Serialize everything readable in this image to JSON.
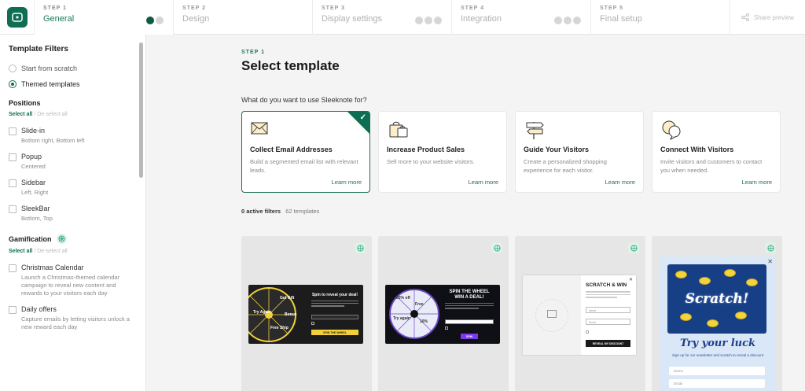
{
  "steps": [
    {
      "num": "STEP 1",
      "label": "General",
      "active": true
    },
    {
      "num": "STEP 2",
      "label": "Design"
    },
    {
      "num": "STEP 3",
      "label": "Display settings"
    },
    {
      "num": "STEP 4",
      "label": "Integration"
    },
    {
      "num": "STEP 5",
      "label": "Final setup"
    }
  ],
  "share_label": "Share preview",
  "sidebar": {
    "title": "Template Filters",
    "radio": [
      "Start from scratch",
      "Themed templates"
    ],
    "positions": {
      "title": "Positions",
      "select_all": "Select all",
      "separator": "/",
      "deselect_all": "De-select all",
      "items": [
        {
          "title": "Slide-in",
          "sub": "Bottom right, Bottom left"
        },
        {
          "title": "Popup",
          "sub": "Centered"
        },
        {
          "title": "Sidebar",
          "sub": "Left, Right"
        },
        {
          "title": "SleekBar",
          "sub": "Bottom, Top"
        }
      ]
    },
    "gamification": {
      "title": "Gamification",
      "select_all": "Select all",
      "separator": "/",
      "deselect_all": "De-select all",
      "items": [
        {
          "title": "Christmas Calendar",
          "sub": "Launch a Christmas-themed calendar campaign to reveal new content and rewards to your visitors each day"
        },
        {
          "title": "Daily offers",
          "sub": "Capture emails by letting visitors unlock a new reward each day"
        }
      ]
    }
  },
  "main": {
    "eyebrow": "STEP 1",
    "title": "Select template",
    "question": "What do you want to use Sleeknote for?",
    "cards": [
      {
        "title": "Collect Email Addresses",
        "desc": "Build a segmented email list with relevant leads.",
        "link": "Learn more",
        "icon": "envelope-icon"
      },
      {
        "title": "Increase Product Sales",
        "desc": "Sell more to your website visitors.",
        "link": "Learn more",
        "icon": "shopping-bag-icon"
      },
      {
        "title": "Guide Your Visitors",
        "desc": "Create a personalized shopping experience for each visitor.",
        "link": "Learn more",
        "icon": "signpost-icon"
      },
      {
        "title": "Connect With Visitors",
        "desc": "Invite visitors and customers to contact you when needed.",
        "link": "Learn more",
        "icon": "chat-bubbles-icon"
      }
    ],
    "filters_count": "0 active filters",
    "templates_count": "62 templates",
    "templates": {
      "t1": {
        "title": "Spin to reveal your deal!",
        "button": "SPIN THE WHEEL",
        "wheel": [
          "Get Gift",
          "Try Again",
          "Free Ship",
          "Bonus"
        ]
      },
      "t2": {
        "title": "SPIN THE WHEEL WIN A DEAL!",
        "button": "SPIN",
        "wheel": [
          "20% off",
          "Free",
          "Try again",
          "10%"
        ]
      },
      "t3": {
        "title": "SCRATCH & WIN",
        "button": "REVEAL MY DISCOUNT",
        "field1": "Name",
        "field2": "Email"
      },
      "t4": {
        "title": "Scratch!",
        "subtitle": "Try your luck",
        "sub": "Sign up for our newsletter and scratch to reveal a discount",
        "field1": "Name",
        "field2": "Email"
      }
    }
  }
}
